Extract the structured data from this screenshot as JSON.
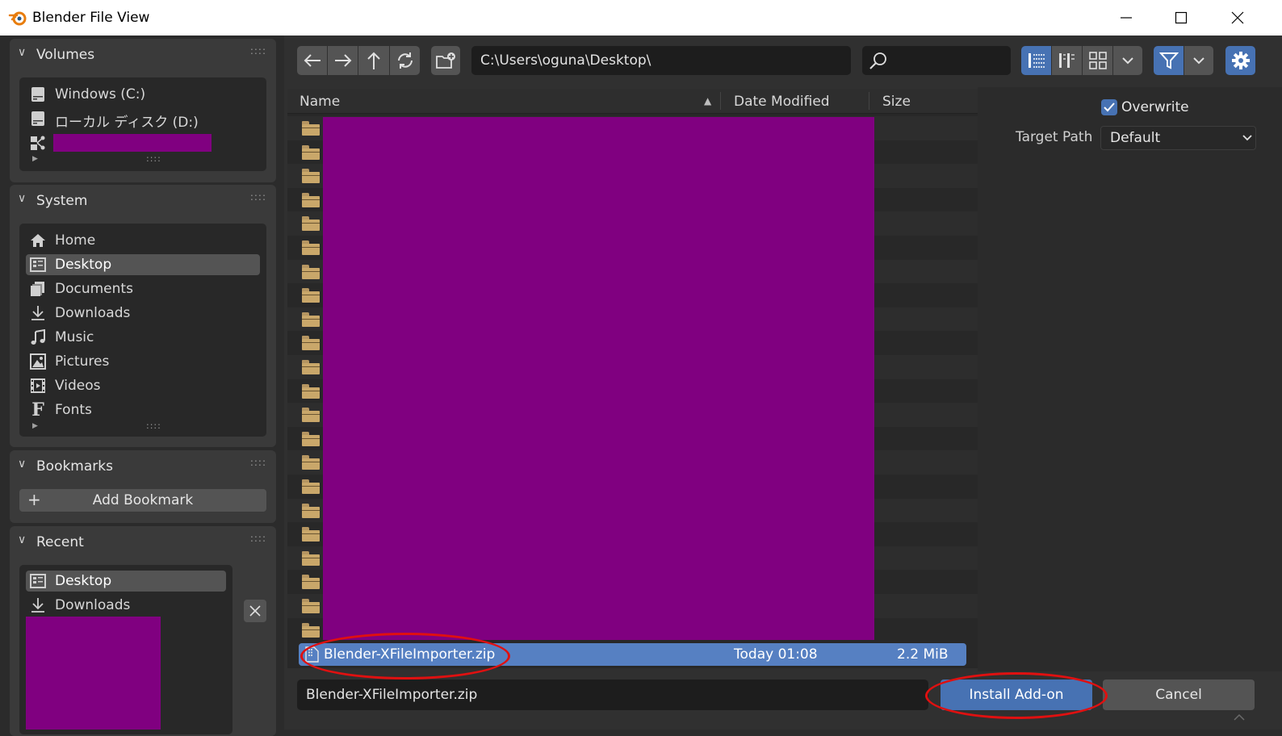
{
  "window": {
    "title": "Blender File View",
    "controls": {
      "minimize": "—",
      "maximize": "☐",
      "close": "✕"
    }
  },
  "sidebar": {
    "volumes": {
      "title": "Volumes",
      "items": [
        {
          "label": "Windows (C:)",
          "icon": "drive-icon"
        },
        {
          "label": "ローカル ディスク (D:)",
          "icon": "drive-icon"
        },
        {
          "label": "",
          "icon": "network-icon"
        }
      ]
    },
    "system": {
      "title": "System",
      "items": [
        {
          "label": "Home",
          "icon": "home-icon"
        },
        {
          "label": "Desktop",
          "icon": "desktop-icon",
          "selected": true
        },
        {
          "label": "Documents",
          "icon": "documents-icon"
        },
        {
          "label": "Downloads",
          "icon": "download-icon"
        },
        {
          "label": "Music",
          "icon": "music-icon"
        },
        {
          "label": "Pictures",
          "icon": "pictures-icon"
        },
        {
          "label": "Videos",
          "icon": "videos-icon"
        },
        {
          "label": "Fonts",
          "icon": "font-icon"
        }
      ]
    },
    "bookmarks": {
      "title": "Bookmarks",
      "add_label": "Add Bookmark"
    },
    "recent": {
      "title": "Recent",
      "items": [
        {
          "label": "Desktop",
          "icon": "desktop-icon",
          "selected": true
        },
        {
          "label": "Downloads",
          "icon": "download-icon"
        }
      ]
    }
  },
  "toolbar": {
    "path": "C:\\Users\\oguna\\Desktop\\",
    "search_value": ""
  },
  "filelist": {
    "columns": {
      "name": "Name",
      "date": "Date Modified",
      "size": "Size"
    },
    "sort_indicator": "▲",
    "folder_rows": 22,
    "selected_file": {
      "name": "Blender-XFileImporter.zip",
      "date": "Today 01:08",
      "size": "2.2 MiB"
    }
  },
  "options": {
    "overwrite_label": "Overwrite",
    "overwrite_checked": true,
    "target_path_label": "Target Path",
    "target_path_value": "Default"
  },
  "footer": {
    "filename": "Blender-XFileImporter.zip",
    "install_label": "Install Add-on",
    "cancel_label": "Cancel"
  },
  "colors": {
    "accent": "#4772b3",
    "selection": "#5680c2",
    "redaction": "#800080",
    "annotation": "#e01010",
    "folder": "#c9a76a"
  }
}
